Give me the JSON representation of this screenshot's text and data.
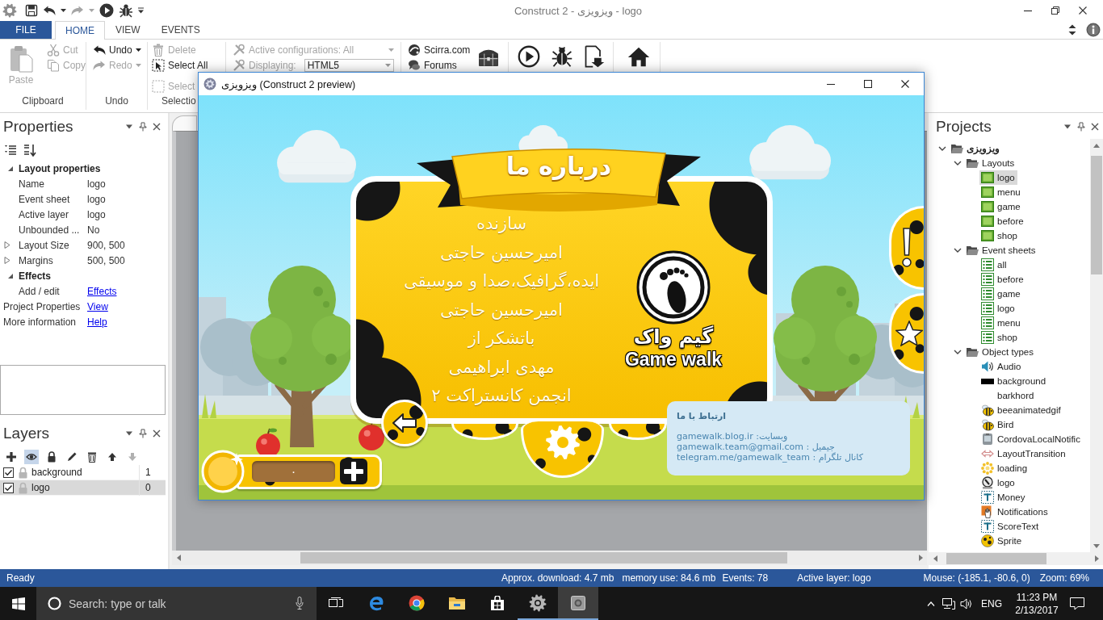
{
  "title_bar": {
    "title": "Construct 2 - ویزویزی - logo",
    "quick_access": [
      {
        "disabled": false
      },
      {
        "disabled": false
      },
      {
        "disabled": true
      },
      {
        "disabled": false
      },
      {
        "disabled": false
      }
    ]
  },
  "ribbon_tabs": [
    {
      "label": "FILE",
      "kind": "backstage",
      "selected": false
    },
    {
      "label": "HOME",
      "kind": "tab",
      "selected": true
    },
    {
      "label": "VIEW",
      "kind": "tab",
      "selected": false
    },
    {
      "label": "EVENTS",
      "kind": "tab",
      "selected": false
    }
  ],
  "ribbon": {
    "clipboard": {
      "label": "Clipboard",
      "paste": {
        "label": "Paste",
        "disabled": true
      },
      "cut": {
        "label": "Cut",
        "disabled": true
      },
      "copy": {
        "label": "Copy",
        "disabled": true
      }
    },
    "undo": {
      "label": "Undo",
      "undo": {
        "label": "Undo",
        "disabled": false
      },
      "redo": {
        "label": "Redo",
        "disabled": true
      }
    },
    "selection": {
      "label": "Selectio",
      "delete": {
        "label": "Delete",
        "disabled": true
      },
      "select_all": {
        "label": "Select All",
        "disabled": false
      },
      "select": {
        "label": "Select",
        "disabled": true
      }
    },
    "configuration": {
      "active": {
        "label": "Active configurations: All",
        "disabled": true
      },
      "displaying": {
        "label": "Displaying:",
        "value": "HTML5",
        "disabled": true
      }
    },
    "links": {
      "scirra": {
        "label": "Scirra.com"
      },
      "forums": {
        "label": "Forums"
      }
    }
  },
  "properties_panel": {
    "title": "Properties",
    "rows": [
      {
        "kind": "category",
        "label": "Layout properties",
        "expanded": true,
        "children": [
          {
            "kind": "value",
            "label": "Name",
            "value": "logo"
          },
          {
            "kind": "value",
            "label": "Event sheet",
            "value": "logo"
          },
          {
            "kind": "value",
            "label": "Active layer",
            "value": "logo"
          },
          {
            "kind": "value",
            "label": "Unbounded ...",
            "value": "No"
          },
          {
            "kind": "compound",
            "label": "Layout Size",
            "value": "900, 500",
            "expanded": false
          },
          {
            "kind": "compound",
            "label": "Margins",
            "value": "500, 500",
            "expanded": false
          }
        ]
      },
      {
        "kind": "category",
        "label": "Effects",
        "expanded": true,
        "children": [
          {
            "kind": "link",
            "label": "Add / edit",
            "link": "Effects"
          }
        ]
      },
      {
        "kind": "link",
        "label": "Project Properties",
        "link": "View"
      },
      {
        "kind": "link",
        "label": "More information",
        "link": "Help"
      }
    ]
  },
  "layers_panel": {
    "title": "Layers",
    "tools": [
      {
        "on": false,
        "disabled": false
      },
      {
        "on": true,
        "disabled": false
      },
      {
        "on": false,
        "disabled": false
      },
      {
        "on": false,
        "disabled": false
      },
      {
        "on": false,
        "disabled": false
      },
      {
        "on": false,
        "disabled": false
      },
      {
        "on": false,
        "disabled": true
      }
    ],
    "layers": [
      {
        "name": "background",
        "number": "1",
        "checked": true,
        "locked": false,
        "selected": false
      },
      {
        "name": "logo",
        "number": "0",
        "checked": true,
        "locked": false,
        "selected": true
      }
    ]
  },
  "projects_panel": {
    "title": "Projects",
    "tree": [
      {
        "label": "ویزویزی",
        "kind": "folder",
        "expanded": true,
        "selected": false,
        "children": [
          {
            "label": "Layouts",
            "kind": "folder",
            "expanded": true,
            "selected": false,
            "children": [
              {
                "label": "logo",
                "kind": "layout",
                "selected": true
              },
              {
                "label": "menu",
                "kind": "layout",
                "selected": false
              },
              {
                "label": "game",
                "kind": "layout",
                "selected": false
              },
              {
                "label": "before",
                "kind": "layout",
                "selected": false
              },
              {
                "label": "shop",
                "kind": "layout",
                "selected": false
              }
            ]
          },
          {
            "label": "Event sheets",
            "kind": "folder",
            "expanded": true,
            "selected": false,
            "children": [
              {
                "label": "all",
                "kind": "events",
                "selected": false
              },
              {
                "label": "before",
                "kind": "events",
                "selected": false
              },
              {
                "label": "game",
                "kind": "events",
                "selected": false
              },
              {
                "label": "logo",
                "kind": "events",
                "selected": false
              },
              {
                "label": "menu",
                "kind": "events",
                "selected": false
              },
              {
                "label": "shop",
                "kind": "events",
                "selected": false
              }
            ]
          },
          {
            "label": "Object types",
            "kind": "folder",
            "expanded": true,
            "selected": false,
            "children": [
              {
                "label": "Audio",
                "kind": "audio",
                "selected": false
              },
              {
                "label": "background",
                "kind": "solid",
                "selected": false
              },
              {
                "label": "barkhord",
                "kind": "blank",
                "selected": false
              },
              {
                "label": "beeanimatedgif",
                "kind": "bee",
                "selected": false
              },
              {
                "label": "Bird",
                "kind": "bee",
                "selected": false
              },
              {
                "label": "CordovaLocalNotific",
                "kind": "device",
                "selected": false
              },
              {
                "label": "LayoutTransition",
                "kind": "transition",
                "selected": false
              },
              {
                "label": "loading",
                "kind": "spinner",
                "selected": false
              },
              {
                "label": "logo",
                "kind": "badge",
                "selected": false
              },
              {
                "label": "Money",
                "kind": "text",
                "selected": false
              },
              {
                "label": "Notifications",
                "kind": "touch",
                "selected": false
              },
              {
                "label": "ScoreText",
                "kind": "text",
                "selected": false
              },
              {
                "label": "Sprite",
                "kind": "ball",
                "selected": false
              }
            ]
          }
        ]
      }
    ]
  },
  "status_bar": {
    "message": "Ready",
    "fields": [
      "Approx. download: 4.7 mb",
      "memory use: 84.6 mb",
      "Events: 78",
      "Active layer: logo",
      "Mouse: (-185.1, -80.6, 0)",
      "Zoom: 69%"
    ]
  },
  "taskbar": {
    "search": {
      "placeholder": "Search: type or talk"
    },
    "apps": [
      {
        "running": false,
        "selected": false
      },
      {
        "running": false,
        "selected": false
      },
      {
        "running": false,
        "selected": false
      },
      {
        "running": false,
        "selected": false
      },
      {
        "running": false,
        "selected": false
      },
      {
        "running": true,
        "selected": false
      },
      {
        "running": true,
        "selected": true
      }
    ],
    "language": "ENG",
    "time": "11:23 PM",
    "date": "2/13/2017"
  },
  "preview_window": {
    "title": "ویزویزی (Construct 2 preview)",
    "game": {
      "banner": "درباره ما",
      "credits": [
        "سازنده",
        "امیرحسین حاجتی",
        "ایده،گرافیک،صدا و موسیقی",
        "امیرحسین حاجتی",
        "باتشکر از",
        "مهدی ابراهیمی",
        "انجمن کانستراکت ۲"
      ],
      "logo_title": "گیم واک",
      "logo_subtitle": "Game walk",
      "contact": {
        "title": "ارتباط با ما",
        "lines": [
          "وبسایت: gamewalk.blog.ir",
          "جیمیل : gamewalk.team@gmail.com",
          "کانال تلگرام : telegram.me/gamewalk_team"
        ]
      },
      "coins": "۰"
    }
  }
}
